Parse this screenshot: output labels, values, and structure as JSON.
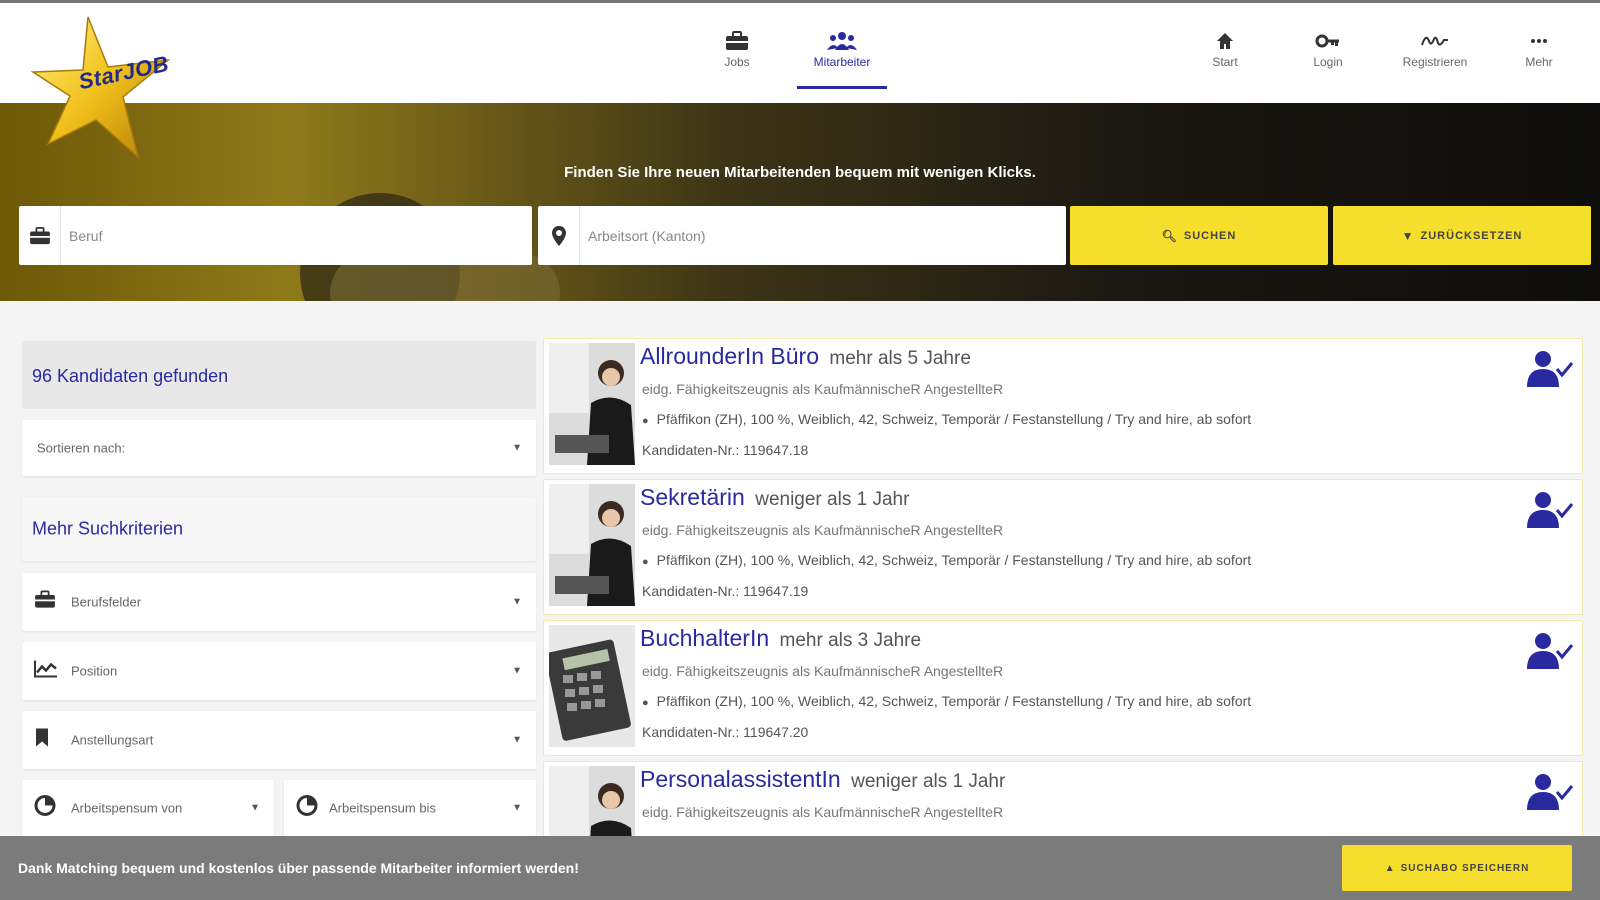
{
  "logo": {
    "text": "StarJOB"
  },
  "nav": {
    "center": [
      {
        "label": "Jobs",
        "icon": "briefcase-icon"
      },
      {
        "label": "Mitarbeiter",
        "icon": "people-icon",
        "active": true
      }
    ],
    "right": [
      {
        "label": "Start",
        "icon": "home-icon"
      },
      {
        "label": "Login",
        "icon": "key-icon"
      },
      {
        "label": "Registrieren",
        "icon": "signature-icon"
      },
      {
        "label": "Mehr",
        "icon": "more-icon"
      }
    ]
  },
  "hero": {
    "tagline": "Finden Sie Ihre neuen Mitarbeitenden bequem mit wenigen Klicks.",
    "beruf_placeholder": "Beruf",
    "ort_placeholder": "Arbeitsort (Kanton)",
    "search_label": "SUCHEN",
    "reset_label": "ZURÜCKSETZEN"
  },
  "sidebar": {
    "found": "96 Kandidaten gefunden",
    "sort_label": "Sortieren nach:",
    "criteria_title": "Mehr Suchkriterien",
    "filters": [
      {
        "label": "Berufsfelder",
        "icon": "briefcase-icon"
      },
      {
        "label": "Position",
        "icon": "chart-icon"
      },
      {
        "label": "Anstellungsart",
        "icon": "bookmark-icon"
      }
    ],
    "pensum_from": "Arbeitspensum von",
    "pensum_to": "Arbeitspensum bis"
  },
  "results": [
    {
      "title": "AllrounderIn Büro",
      "experience": "mehr als 5 Jahre",
      "qualification": "eidg. Fähigkeitszeugnis als KaufmännischeR AngestellteR",
      "details": "Pfäffikon (ZH), 100 %, Weiblich, 42, Schweiz, Temporär / Festanstellung / Try and hire, ab sofort",
      "number": "Kandidaten-Nr.: 119647.18"
    },
    {
      "title": "Sekretärin",
      "experience": "weniger als 1 Jahr",
      "qualification": "eidg. Fähigkeitszeugnis als KaufmännischeR AngestellteR",
      "details": "Pfäffikon (ZH), 100 %, Weiblich, 42, Schweiz, Temporär / Festanstellung / Try and hire, ab sofort",
      "number": "Kandidaten-Nr.: 119647.19"
    },
    {
      "title": "BuchhalterIn",
      "experience": "mehr als 3 Jahre",
      "qualification": "eidg. Fähigkeitszeugnis als KaufmännischeR AngestellteR",
      "details": "Pfäffikon (ZH), 100 %, Weiblich, 42, Schweiz, Temporär / Festanstellung / Try and hire, ab sofort",
      "number": "Kandidaten-Nr.: 119647.20"
    },
    {
      "title": "PersonalassistentIn",
      "experience": "weniger als 1 Jahr",
      "qualification": "eidg. Fähigkeitszeugnis als KaufmännischeR AngestellteR",
      "details": "",
      "number": ""
    }
  ],
  "bottombar": {
    "message": "Dank Matching bequem und kostenlos über passende Mitarbeiter informiert werden!",
    "save_label": "SUCHABO SPEICHERN"
  },
  "colors": {
    "accent_yellow": "#f5de2c",
    "link_blue": "#2a2aa0",
    "bottombar_gray": "#7b7b7b"
  }
}
